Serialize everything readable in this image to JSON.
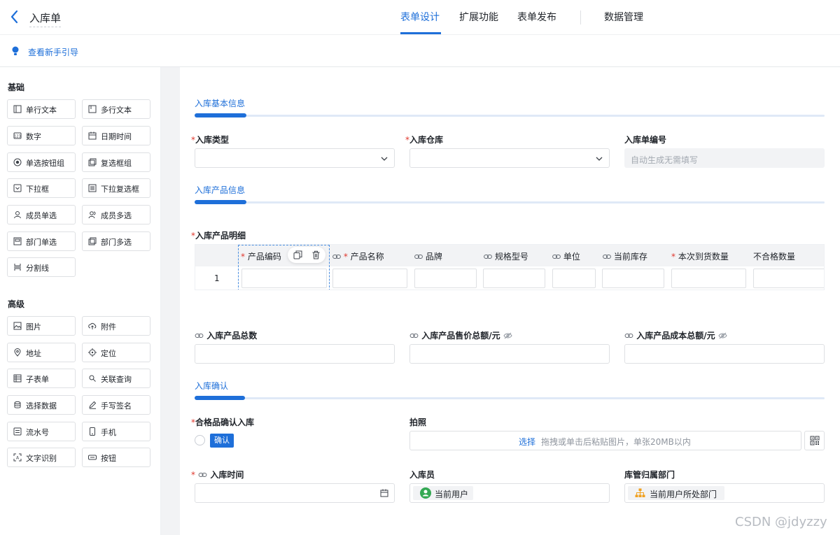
{
  "header": {
    "title": "入库单",
    "tabs": [
      "表单设计",
      "扩展功能",
      "表单发布",
      "数据管理"
    ],
    "active_tab": "表单设计"
  },
  "guide": {
    "label": "查看新手引导"
  },
  "sidebar": {
    "basic_title": "基础",
    "basic_items": [
      "单行文本",
      "多行文本",
      "数字",
      "日期时间",
      "单选按钮组",
      "复选框组",
      "下拉框",
      "下拉复选框",
      "成员单选",
      "成员多选",
      "部门单选",
      "部门多选",
      "分割线"
    ],
    "advanced_title": "高级",
    "advanced_items": [
      "图片",
      "附件",
      "地址",
      "定位",
      "子表单",
      "关联查询",
      "选择数据",
      "手写签名",
      "流水号",
      "手机",
      "文字识别",
      "按钮"
    ]
  },
  "form": {
    "section1": "入库基本信息",
    "inbound_type_label": "入库类型",
    "warehouse_label": "入库仓库",
    "order_no_label": "入库单编号",
    "order_no_placeholder": "自动生成无需填写",
    "section2": "入库产品信息",
    "detail_label": "入库产品明细",
    "columns": [
      "产品编码",
      "产品名称",
      "品牌",
      "规格型号",
      "单位",
      "当前库存",
      "本次到货数量",
      "不合格数量"
    ],
    "row_index": "1",
    "total_qty_label": "入库产品总数",
    "total_price_label": "入库产品售价总额/元",
    "total_cost_label": "入库产品成本总额/元",
    "section3": "入库确认",
    "qualified_label": "合格品确认入库",
    "confirm_option": "确认",
    "photo_label": "拍照",
    "upload_link": "选择",
    "upload_hint": "拖拽或单击后粘贴图片，单张20MB以内",
    "time_label": "入库时间",
    "operator_label": "入库员",
    "operator_value": "当前用户",
    "dept_label": "库管归属部门",
    "dept_value": "当前用户所处部门"
  },
  "watermark": "CSDN @jdyzzy",
  "colors": {
    "accent": "#1e6fd9",
    "required": "#e0382e"
  }
}
